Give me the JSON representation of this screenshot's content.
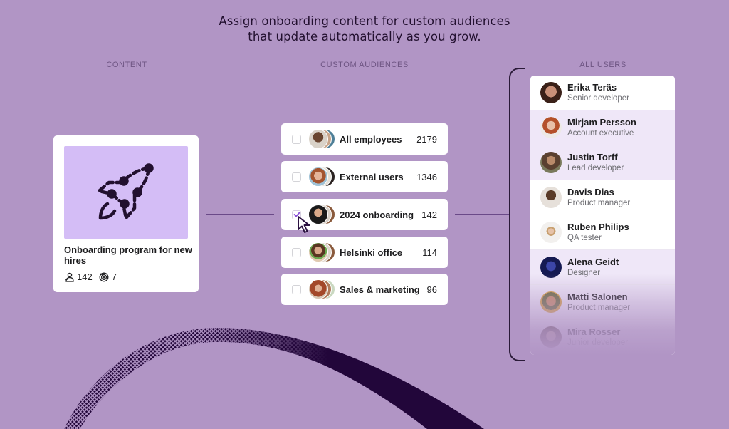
{
  "headline": {
    "line1": "Assign onboarding content for custom audiences",
    "line2": "that update automatically as you grow."
  },
  "columns": {
    "content": "CONTENT",
    "audiences": "CUSTOM AUDIENCES",
    "users": "ALL USERS"
  },
  "content_card": {
    "icon": "rocket-icon",
    "title": "Onboarding program for new hires",
    "learners_icon": "learners-icon",
    "learners": "142",
    "tasks_icon": "target-icon",
    "tasks": "7"
  },
  "audiences": [
    {
      "name": "All employees",
      "count": "2179",
      "checked": false
    },
    {
      "name": "External users",
      "count": "1346",
      "checked": false
    },
    {
      "name": "2024 onboarding",
      "count": "142",
      "checked": true
    },
    {
      "name": "Helsinki office",
      "count": "114",
      "checked": false
    },
    {
      "name": "Sales & marketing",
      "count": "96",
      "checked": false
    }
  ],
  "users": [
    {
      "name": "Erika Teräs",
      "role": "Senior developer"
    },
    {
      "name": "Mirjam Persson",
      "role": "Account executive"
    },
    {
      "name": "Justin Torff",
      "role": "Lead developer"
    },
    {
      "name": "Davis Dias",
      "role": "Product manager"
    },
    {
      "name": "Ruben Philips",
      "role": "QA tester"
    },
    {
      "name": "Alena Geidt",
      "role": "Designer"
    },
    {
      "name": "Matti Salonen",
      "role": "Product manager"
    },
    {
      "name": "Mira Rosser",
      "role": "Junior developer"
    }
  ],
  "colors": {
    "background": "#b195c5",
    "accent": "#8a4fd8",
    "dark": "#22102f",
    "thumb": "#d4bdf6"
  }
}
